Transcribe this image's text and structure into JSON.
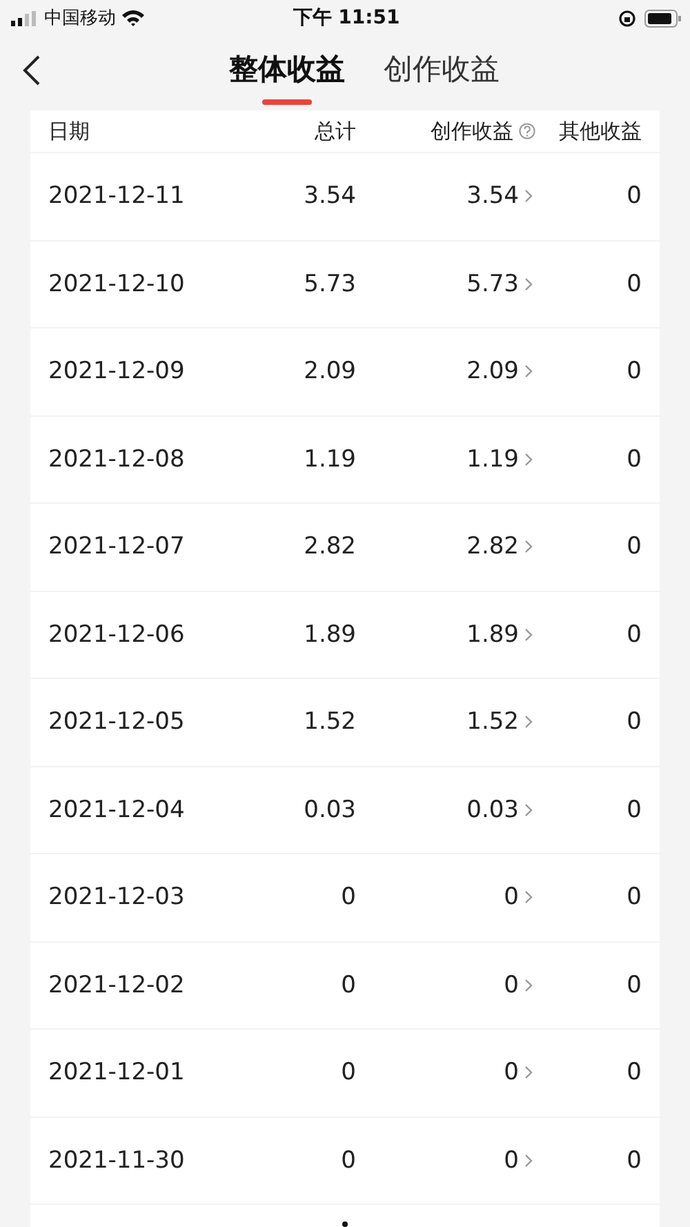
{
  "status_bar": {
    "carrier": "中国移动",
    "time": "下午 11:51"
  },
  "tabs": [
    {
      "label": "整体收益",
      "selected": true
    },
    {
      "label": "创作收益",
      "selected": false
    }
  ],
  "table": {
    "columns": [
      "日期",
      "总计",
      "创作收益",
      "其他收益"
    ],
    "rows": [
      {
        "date": "2021-12-11",
        "total": "3.54",
        "creation": "3.54",
        "other": "0"
      },
      {
        "date": "2021-12-10",
        "total": "5.73",
        "creation": "5.73",
        "other": "0"
      },
      {
        "date": "2021-12-09",
        "total": "2.09",
        "creation": "2.09",
        "other": "0"
      },
      {
        "date": "2021-12-08",
        "total": "1.19",
        "creation": "1.19",
        "other": "0"
      },
      {
        "date": "2021-12-07",
        "total": "2.82",
        "creation": "2.82",
        "other": "0"
      },
      {
        "date": "2021-12-06",
        "total": "1.89",
        "creation": "1.89",
        "other": "0"
      },
      {
        "date": "2021-12-05",
        "total": "1.52",
        "creation": "1.52",
        "other": "0"
      },
      {
        "date": "2021-12-04",
        "total": "0.03",
        "creation": "0.03",
        "other": "0"
      },
      {
        "date": "2021-12-03",
        "total": "0",
        "creation": "0",
        "other": "0"
      },
      {
        "date": "2021-12-02",
        "total": "0",
        "creation": "0",
        "other": "0"
      },
      {
        "date": "2021-12-01",
        "total": "0",
        "creation": "0",
        "other": "0"
      },
      {
        "date": "2021-11-30",
        "total": "0",
        "creation": "0",
        "other": "0"
      }
    ]
  }
}
